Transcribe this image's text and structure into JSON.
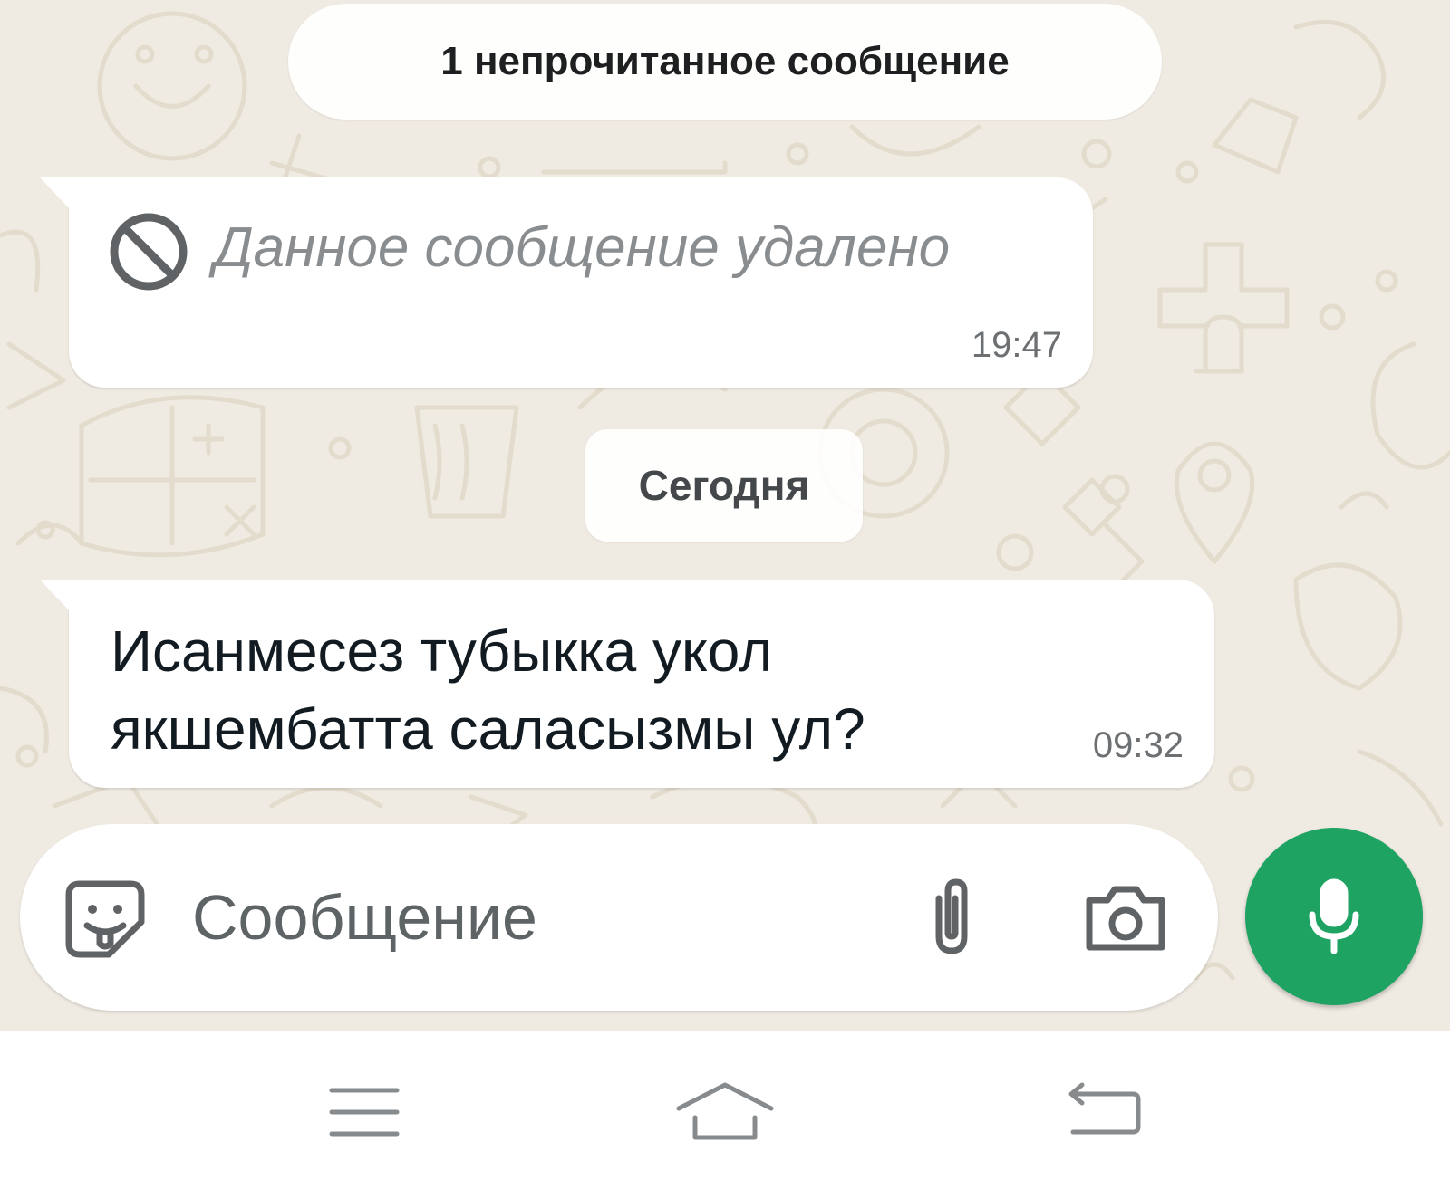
{
  "chat": {
    "unread_banner": "1 непрочитанное сообщение",
    "date_divider": "Сегодня",
    "messages": [
      {
        "type": "deleted",
        "icon": "prohibited-icon",
        "text": "Данное сообщение удалено",
        "time": "19:47"
      },
      {
        "type": "incoming",
        "text": "Исанмесез тубыкка укол якшембатта саласызмы ул?",
        "time": "09:32"
      }
    ]
  },
  "composer": {
    "placeholder": "Сообщение",
    "emoji_icon": "sticker-face-icon",
    "attach_icon": "paperclip-icon",
    "camera_icon": "camera-icon",
    "mic_icon": "microphone-icon"
  },
  "navbar": {
    "recents_icon": "recents-icon",
    "home_icon": "home-icon",
    "back_icon": "back-icon"
  },
  "colors": {
    "chat_background": "#efeae2",
    "bubble": "#ffffff",
    "accent_green": "#1ea362",
    "deleted_text": "#8a8d8f",
    "timestamp": "#6d7072"
  }
}
